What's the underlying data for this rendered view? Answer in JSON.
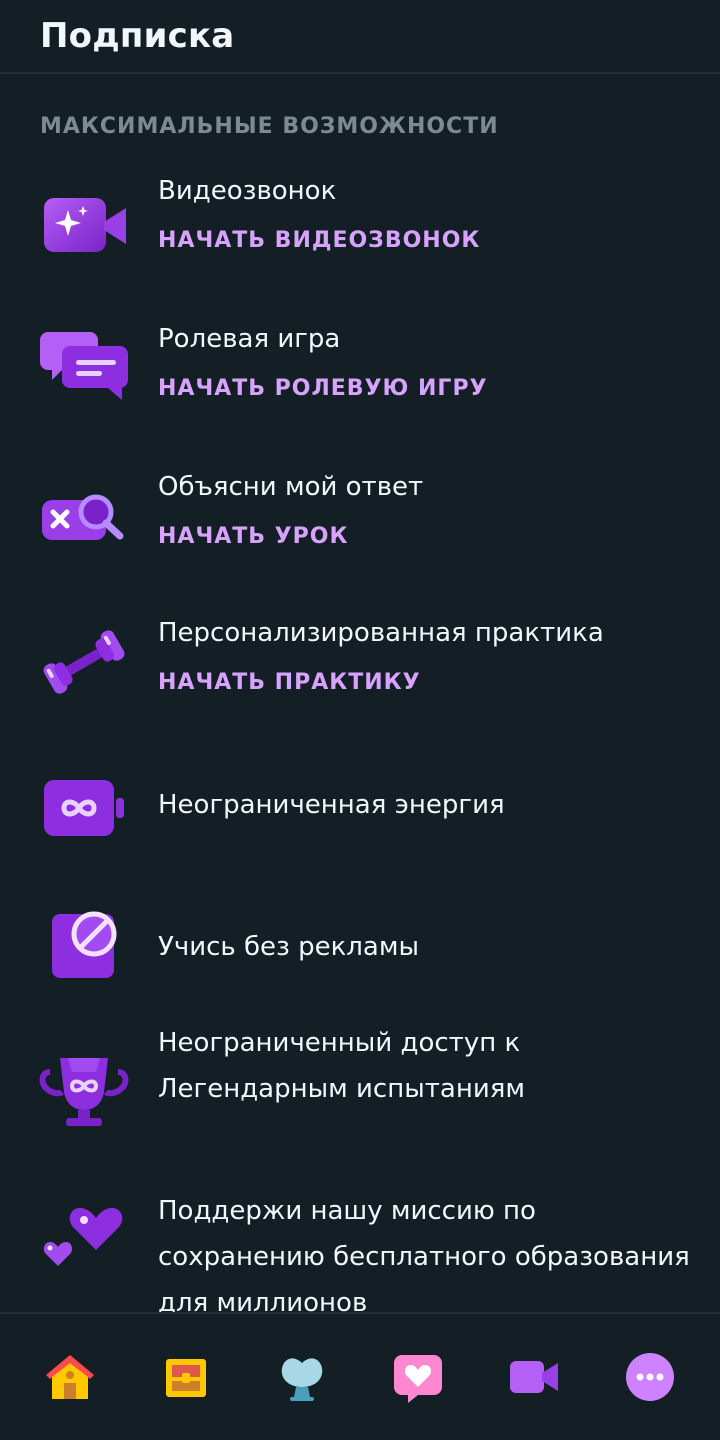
{
  "header": {
    "title": "Подписка"
  },
  "section": {
    "title": "МАКСИМАЛЬНЫЕ ВОЗМОЖНОСТИ"
  },
  "features": [
    {
      "icon": "video-sparkle-icon",
      "title": "Видеозвонок",
      "action": "НАЧАТЬ ВИДЕОЗВОНОК"
    },
    {
      "icon": "chat-bubbles-icon",
      "title": "Ролевая игра",
      "action": "НАЧАТЬ РОЛЕВУЮ ИГРУ"
    },
    {
      "icon": "explain-search-icon",
      "title": "Объясни мой ответ",
      "action": "НАЧАТЬ УРОК"
    },
    {
      "icon": "dumbbell-icon",
      "title": "Персонализированная практика",
      "action": "НАЧАТЬ ПРАКТИКУ"
    },
    {
      "icon": "infinity-battery-icon",
      "title": "Неограниченная энергия"
    },
    {
      "icon": "no-ads-icon",
      "title": "Учись без рекламы"
    },
    {
      "icon": "trophy-infinity-icon",
      "title": "Неограниченный доступ к Легендарным испытаниям"
    },
    {
      "icon": "hearts-icon",
      "title": "Поддержи нашу миссию по сохранению бесплатного образования для миллионов"
    }
  ],
  "tabs": [
    {
      "icon": "home-icon",
      "name": "tab-home"
    },
    {
      "icon": "chest-icon",
      "name": "tab-chest"
    },
    {
      "icon": "shell-icon",
      "name": "tab-shell"
    },
    {
      "icon": "heart-card-icon",
      "name": "tab-heart"
    },
    {
      "icon": "video-icon",
      "name": "tab-video"
    },
    {
      "icon": "more-icon",
      "name": "tab-more"
    }
  ],
  "colors": {
    "background": "#131f24",
    "accent": "#d8a3ff",
    "icon_purple": "#9a3ee8",
    "muted": "#7b8a93"
  }
}
